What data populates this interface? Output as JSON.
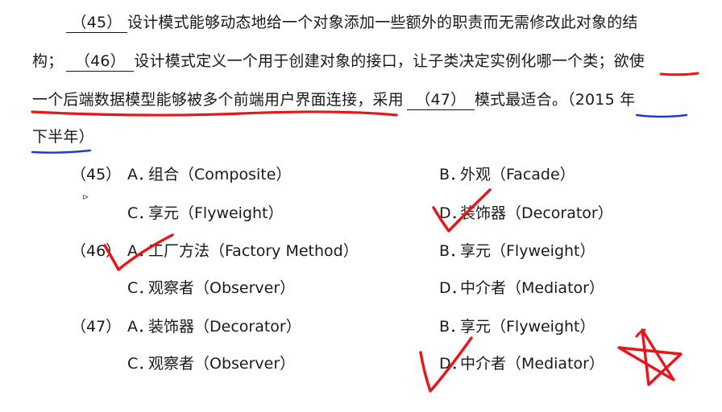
{
  "paragraph": {
    "line1": {
      "blank": "（45）",
      "text": "设计模式能够动态地给一个对象添加一些额外的职责而无需修改此对象的结"
    },
    "line2": {
      "pre": "构；",
      "blank": "（46）",
      "text": "设计模式定义一个用于创建对象的接口，让子类决定实例化哪一个类；",
      "highlight": "欲使"
    },
    "line3": {
      "highlight": "一个后端数据模型能够被多个前端用户界面连接，",
      "text": "采用",
      "blank": "（47）",
      "text2": "模式最适合。（",
      "year": "2015 年"
    },
    "line4": {
      "year": "下半年",
      "close": "）"
    }
  },
  "questions": [
    {
      "number": "（45）",
      "options": [
        {
          "letter": "A．",
          "text": "组合（Composite）"
        },
        {
          "letter": "B．",
          "text": "外观（Facade）"
        },
        {
          "letter": "C．",
          "text": "享元（Flyweight）"
        },
        {
          "letter": "D．",
          "text": "装饰器（Decorator）"
        }
      ]
    },
    {
      "number": "（46）",
      "options": [
        {
          "letter": "A．",
          "text": "工厂方法（Factory  Method）"
        },
        {
          "letter": "B．",
          "text": "享元（Flyweight）"
        },
        {
          "letter": "C．",
          "text": "观察者（Observer）"
        },
        {
          "letter": "D．",
          "text": "中介者（Mediator）"
        }
      ]
    },
    {
      "number": "（47）",
      "options": [
        {
          "letter": "A．",
          "text": "装饰器（Decorator）"
        },
        {
          "letter": "B．",
          "text": "享元（Flyweight）"
        },
        {
          "letter": "C．",
          "text": "观察者（Observer）"
        },
        {
          "letter": "D．",
          "text": "中介者（Mediator）"
        }
      ]
    }
  ],
  "ink_colors": {
    "red": "#e8161b",
    "blue": "#1e3cc8"
  }
}
